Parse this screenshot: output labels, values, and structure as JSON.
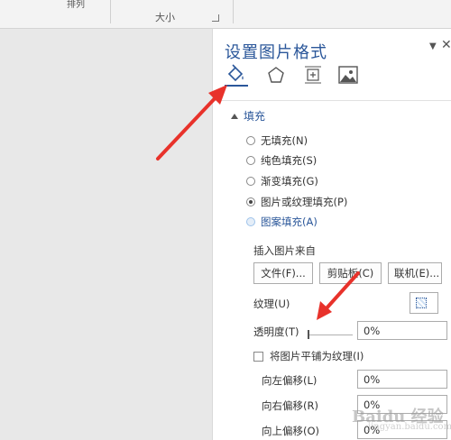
{
  "ribbon": {
    "top_fragment": "排列",
    "size_group_label": "大小"
  },
  "pane": {
    "title": "设置图片格式",
    "menu_icon": "dropdown-arrow",
    "close_icon": "close",
    "tabs": [
      {
        "name": "fill-line",
        "icon": "paint-bucket-icon",
        "active": true
      },
      {
        "name": "effects",
        "icon": "pentagon-icon",
        "active": false
      },
      {
        "name": "size-properties",
        "icon": "size-layout-icon",
        "active": false
      },
      {
        "name": "picture",
        "icon": "picture-icon",
        "active": false
      }
    ],
    "accent_color": "#2b579a"
  },
  "fill": {
    "section_title": "填充",
    "options": [
      {
        "label": "无填充(N)",
        "checked": false
      },
      {
        "label": "纯色填充(S)",
        "checked": false
      },
      {
        "label": "渐变填充(G)",
        "checked": false
      },
      {
        "label": "图片或纹理填充(P)",
        "checked": true
      },
      {
        "label": "图案填充(A)",
        "checked": false
      }
    ],
    "insert_from_label": "插入图片来自",
    "file_button": "文件(F)...",
    "clipboard_button": "剪贴板(C)",
    "online_button": "联机(E)...",
    "texture_label": "纹理(U)",
    "transparency_label": "透明度(T)",
    "transparency_value": "0%",
    "transparency_level": 0,
    "tile_checkbox_label": "将图片平铺为纹理(I)",
    "tile_checked": false,
    "offset_left_label": "向左偏移(L)",
    "offset_left_value": "0%",
    "offset_right_label": "向右偏移(R)",
    "offset_right_value": "0%",
    "offset_top_label": "向上偏移(O)",
    "offset_top_value": "0%"
  },
  "annotation": {
    "arrow_color": "#e8322b"
  },
  "watermark": {
    "brand": "Baidu 经验",
    "sub": "jingyan.baidu.com"
  }
}
